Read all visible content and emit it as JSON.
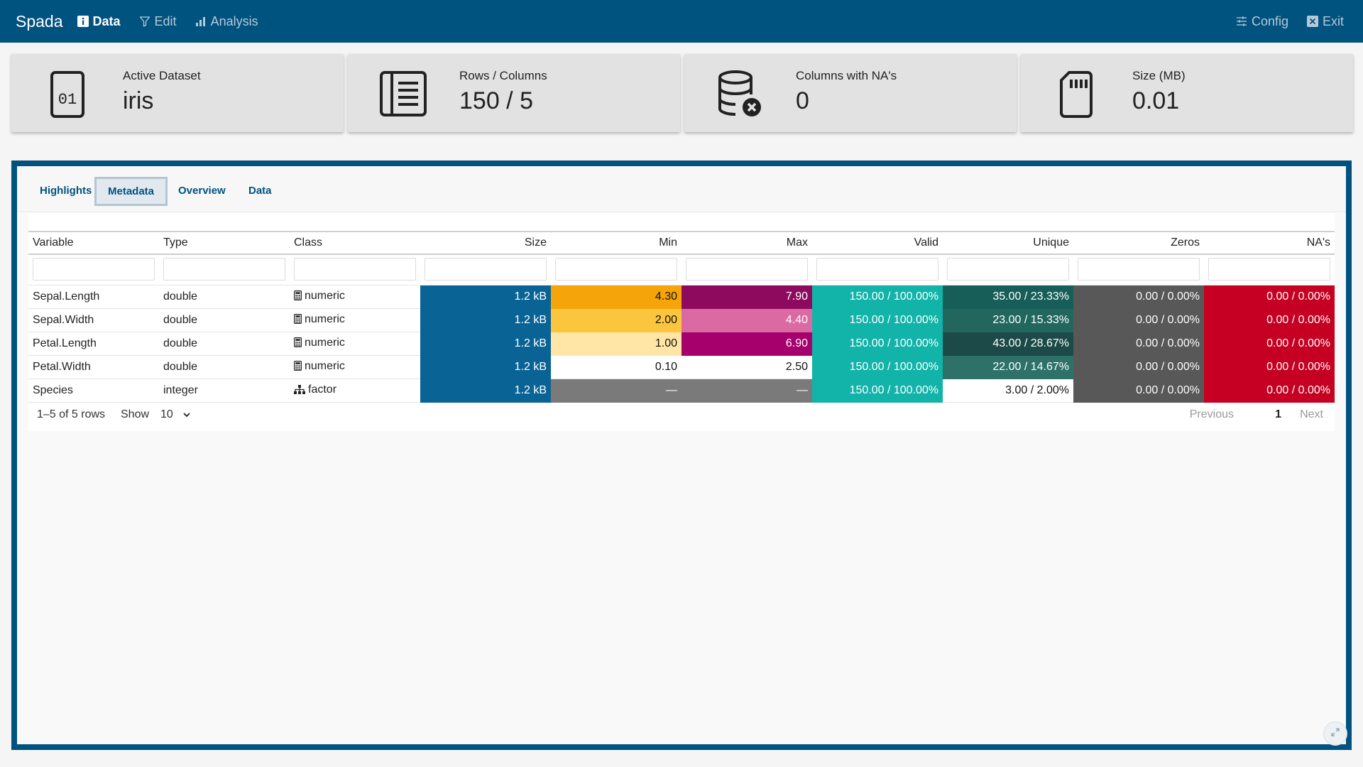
{
  "navbar": {
    "brand": "Spada",
    "tabs": [
      {
        "label": "Data",
        "icon": "info-icon",
        "active": true
      },
      {
        "label": "Edit",
        "icon": "filter-icon",
        "active": false
      },
      {
        "label": "Analysis",
        "icon": "bar-chart-icon",
        "active": false
      }
    ],
    "right": [
      {
        "label": "Config",
        "icon": "sliders-icon"
      },
      {
        "label": "Exit",
        "icon": "close-square-icon"
      }
    ]
  },
  "value_boxes": [
    {
      "label": "Active Dataset",
      "value": "iris",
      "icon": "binary-file-icon"
    },
    {
      "label": "Rows / Columns",
      "value": "150 / 5",
      "icon": "list-document-icon"
    },
    {
      "label": "Columns with NA's",
      "value": "0",
      "icon": "database-x-icon"
    },
    {
      "label": "Size (MB)",
      "value": "0.01",
      "icon": "sd-card-icon"
    }
  ],
  "tabs": [
    "Highlights",
    "Metadata",
    "Overview",
    "Data"
  ],
  "active_tab": "Metadata",
  "table": {
    "columns": [
      "Variable",
      "Type",
      "Class",
      "Size",
      "Min",
      "Max",
      "Valid",
      "Unique",
      "Zeros",
      "NA's"
    ],
    "rows": [
      {
        "variable": "Sepal.Length",
        "type": "double",
        "class": "numeric",
        "size": "1.2 kB",
        "min": "4.30",
        "max": "7.90",
        "valid": "150.00 / 100.00%",
        "unique": "35.00 / 23.33%",
        "zeros": "0.00 / 0.00%",
        "nas": "0.00 / 0.00%"
      },
      {
        "variable": "Sepal.Width",
        "type": "double",
        "class": "numeric",
        "size": "1.2 kB",
        "min": "2.00",
        "max": "4.40",
        "valid": "150.00 / 100.00%",
        "unique": "23.00 / 15.33%",
        "zeros": "0.00 / 0.00%",
        "nas": "0.00 / 0.00%"
      },
      {
        "variable": "Petal.Length",
        "type": "double",
        "class": "numeric",
        "size": "1.2 kB",
        "min": "1.00",
        "max": "6.90",
        "valid": "150.00 / 100.00%",
        "unique": "43.00 / 28.67%",
        "zeros": "0.00 / 0.00%",
        "nas": "0.00 / 0.00%"
      },
      {
        "variable": "Petal.Width",
        "type": "double",
        "class": "numeric",
        "size": "1.2 kB",
        "min": "0.10",
        "max": "2.50",
        "valid": "150.00 / 100.00%",
        "unique": "22.00 / 14.67%",
        "zeros": "0.00 / 0.00%",
        "nas": "0.00 / 0.00%"
      },
      {
        "variable": "Species",
        "type": "integer",
        "class": "factor",
        "size": "1.2 kB",
        "min": "—",
        "max": "—",
        "valid": "150.00 / 100.00%",
        "unique": "3.00 / 2.00%",
        "zeros": "0.00 / 0.00%",
        "nas": "0.00 / 0.00%"
      }
    ],
    "cell_colors": [
      {
        "size": "#0a6395",
        "min": "#f5a50a",
        "max": "#8e0a5e",
        "valid": "#12b3a8",
        "unique": "#175e58",
        "zeros": "#585858",
        "nas": "#c50022"
      },
      {
        "size": "#0a6395",
        "min": "#fbc63e",
        "max": "#db6aa2",
        "valid": "#12b3a8",
        "unique": "#22675e",
        "zeros": "#585858",
        "nas": "#c50022"
      },
      {
        "size": "#0a6395",
        "min": "#ffe6a6",
        "max": "#a5006c",
        "valid": "#12b3a8",
        "unique": "#1c4a48",
        "zeros": "#585858",
        "nas": "#c50022"
      },
      {
        "size": "#0a6395",
        "min": "#ffffff",
        "max": "#ffffff",
        "valid": "#12b3a8",
        "unique": "#2e7168",
        "zeros": "#585858",
        "nas": "#c50022"
      },
      {
        "size": "#0a6395",
        "min": "#7a7a7a",
        "max": "#7a7a7a",
        "valid": "#12b3a8",
        "unique": "#ffffff",
        "zeros": "#585858",
        "nas": "#c50022"
      }
    ],
    "info": "1–5 of 5 rows",
    "show_label": "Show",
    "page_length": "10",
    "prev_label": "Previous",
    "page": "1",
    "next_label": "Next"
  },
  "colors": {
    "navbar": "#00527f",
    "accent": "#00527f"
  }
}
